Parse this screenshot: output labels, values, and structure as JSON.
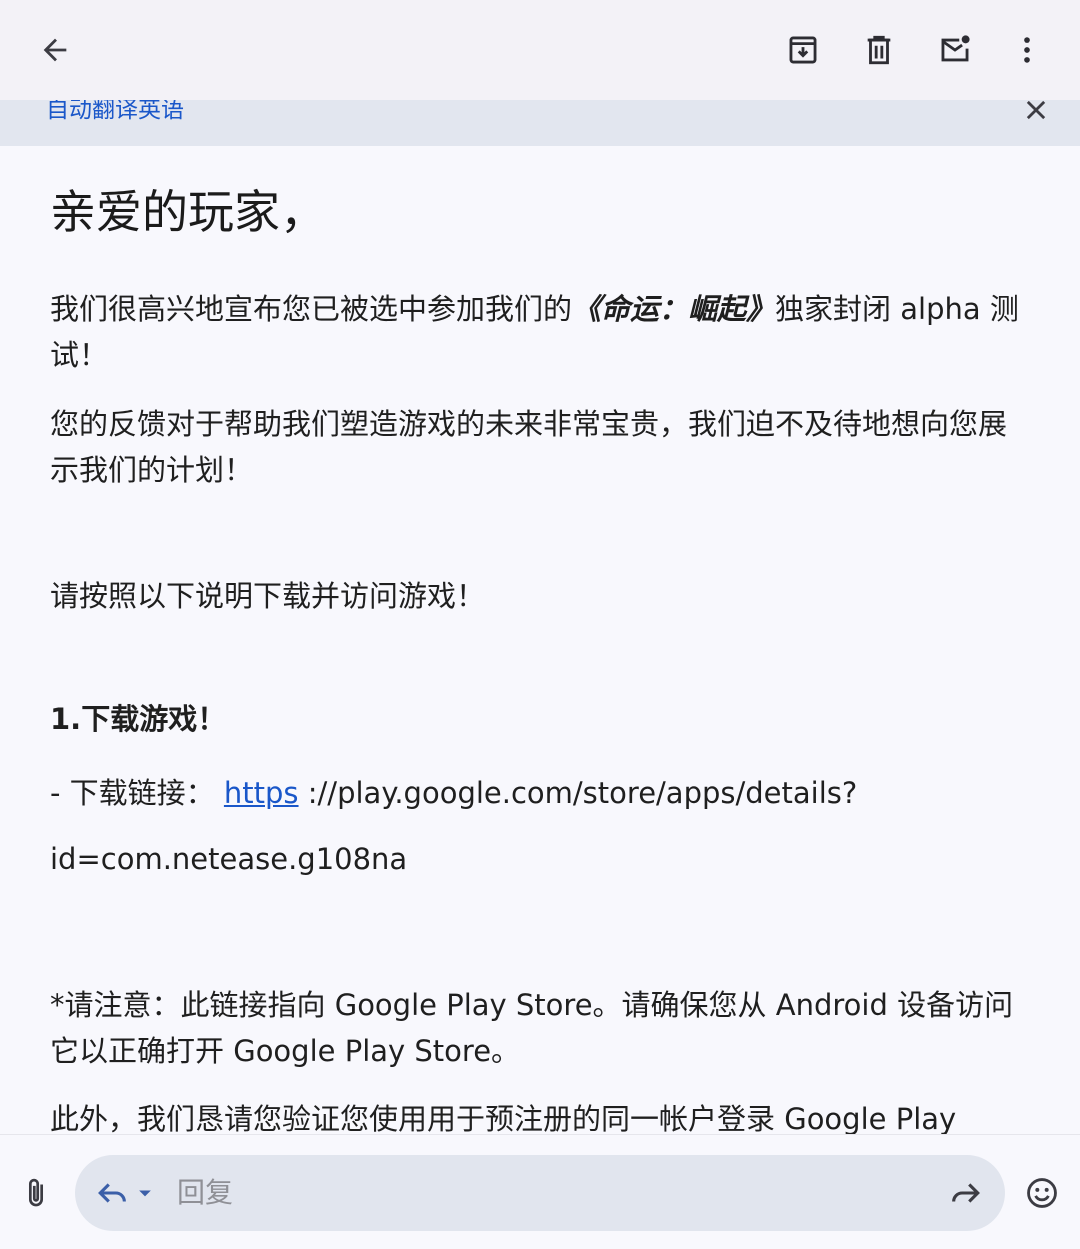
{
  "toolbar": {
    "back_icon": "arrow-back-icon",
    "archive_icon": "archive-icon",
    "delete_icon": "delete-icon",
    "mark_unread_icon": "mark-unread-icon",
    "more_icon": "more-vert-icon"
  },
  "translate_bar": {
    "label": "自动翻译英语",
    "close_icon": "close-icon"
  },
  "email": {
    "greeting": "亲爱的玩家，",
    "p1_before": "我们很高兴地宣布您已被选中参加我们的",
    "p1_title": "《命运：崛起》",
    "p1_after": "独家封闭 alpha 测试！",
    "p2": "您的反馈对于帮助我们塑造游戏的未来非常宝贵，我们迫不及待地想向您展示我们的计划！",
    "p3": "请按照以下说明下载并访问游戏！",
    "step1_title": "1.下载游戏！",
    "download_prefix": "- 下载链接：",
    "download_link": "https",
    "download_rest": "://play.google.com/store/apps/details?",
    "download_id": "id=com.netease.g108na",
    "note": "*请注意：此链接指向 Google Play Store。请确保您从 Android 设备访问它以正确打开 Google Play Store。",
    "p_last": "此外，我们恳请您验证您使用用于预注册的同一帐户登录 Google Play"
  },
  "reply_bar": {
    "attach_icon": "paperclip-icon",
    "reply_icon": "reply-icon",
    "reply_dropdown_icon": "caret-down-icon",
    "placeholder": "回复",
    "forward_icon": "forward-icon",
    "emoji_icon": "emoji-icon"
  },
  "colors": {
    "accent": "#1a57c9",
    "toolbar_bg": "#f3f2f7",
    "banner_bg": "#e2e6ef",
    "pill_bg": "#e1e5ee"
  }
}
